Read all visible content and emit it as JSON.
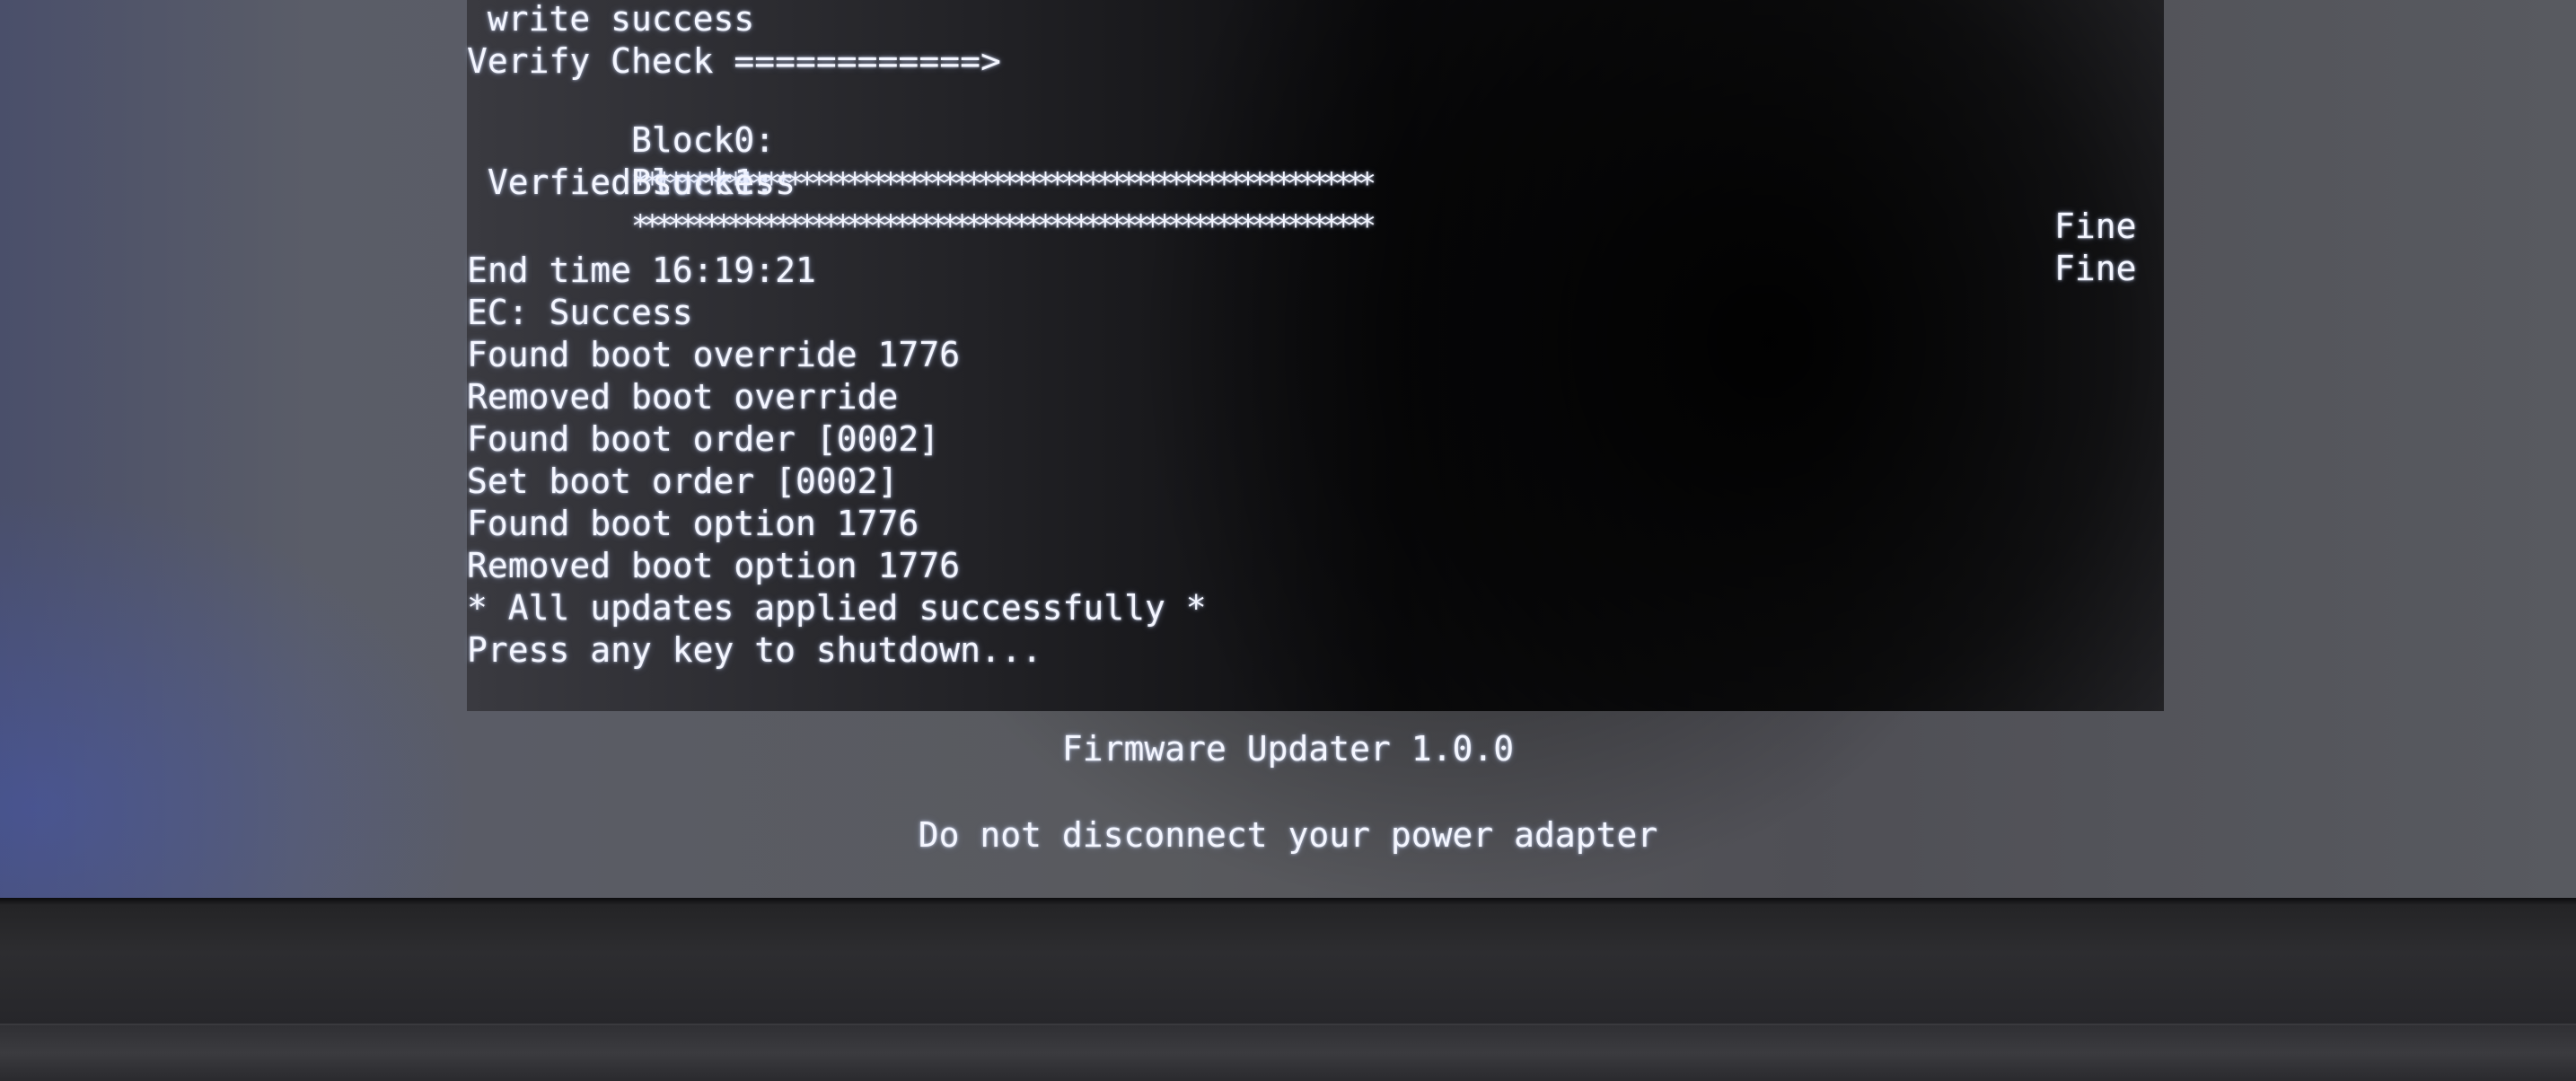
{
  "terminal": {
    "lines": {
      "write_success": " write success",
      "verify_check": "Verify Check ============>",
      "block0_label": "Block0:",
      "block0_stars": "**************************************************************",
      "block0_status": "Fine",
      "block1_label": "Block1:",
      "block1_stars": "**************************************************************",
      "block1_status": "Fine",
      "verified_success": " Verfied success",
      "end_time": "End time 16:19:21",
      "ec_status": "EC: Success",
      "found_boot_override": "Found boot override 1776",
      "removed_boot_override": "Removed boot override",
      "found_boot_order": "Found boot order [0002]",
      "set_boot_order": "Set boot order [0002]",
      "found_boot_option": "Found boot option 1776",
      "removed_boot_option": "Removed boot option 1776",
      "all_updates": "* All updates applied successfully *",
      "press_any_key": "Press any key to shutdown..."
    }
  },
  "footer": {
    "title": "Firmware Updater 1.0.0",
    "warning": "Do not disconnect your power adapter"
  },
  "colors": {
    "text": "#f4f6ff",
    "terminal_bg": "#0c0c0e",
    "screen_bg": "#595a5e",
    "bezel": "#2d2d30"
  }
}
